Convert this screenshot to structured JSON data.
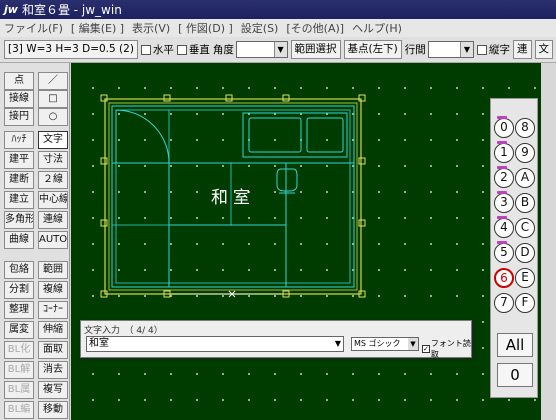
{
  "window": {
    "title": "和室６畳 - jw_win",
    "logo": "jw"
  },
  "menu": [
    {
      "label": "ファイル(F)",
      "disabled": false
    },
    {
      "label": "[ 編集(E) ]",
      "disabled": false
    },
    {
      "label": "表示(V)",
      "disabled": false
    },
    {
      "label": "[ 作図(D) ]",
      "disabled": false
    },
    {
      "label": "設定(S)",
      "disabled": false
    },
    {
      "label": "[その他(A)]",
      "disabled": false
    },
    {
      "label": "ヘルプ(H)",
      "disabled": false
    }
  ],
  "toolbar": {
    "layer_info": "[3]  W=3 H=3 D=0.5 (2)",
    "horizontal": "水平",
    "vertical": "垂直",
    "angle": "角度",
    "range_select": "範囲選択",
    "base_point": "基点(左下)",
    "line_spacing": "行間",
    "vertical_text": "縦字",
    "continuous": "連",
    "text": "文"
  },
  "left_tools": [
    [
      "点",
      "／"
    ],
    [
      "接線",
      "□"
    ],
    [
      "接円",
      "○"
    ],
    [
      "ﾊｯﾁ",
      "文字"
    ],
    [
      "建平",
      "寸法"
    ],
    [
      "建断",
      "２線"
    ],
    [
      "建立",
      "中心線"
    ],
    [
      "多角形",
      "連線"
    ],
    [
      "曲線",
      "AUTO"
    ],
    [
      "包絡",
      "範囲"
    ],
    [
      "分割",
      "複線"
    ],
    [
      "整理",
      "ｺｰﾅｰ"
    ],
    [
      "属変",
      "伸縮"
    ],
    [
      "BL化",
      "面取"
    ],
    [
      "BL解",
      "消去"
    ],
    [
      "BL属",
      "複写"
    ],
    [
      "BL編",
      "移動"
    ]
  ],
  "canvas": {
    "room_label": "和室"
  },
  "right_panel": {
    "left_circles": [
      "0",
      "1",
      "2",
      "3",
      "4",
      "5",
      "6",
      "7"
    ],
    "right_circles": [
      "8",
      "9",
      "A",
      "B",
      "C",
      "D",
      "E",
      "F"
    ],
    "all_label": "All",
    "zero_label": "0",
    "active_color": "#cc0000"
  },
  "text_dialog": {
    "title": "文字入力　（ 4/ 4）",
    "value": "和室",
    "font": "MS ゴシック",
    "font_read_label": "フォント読取"
  }
}
